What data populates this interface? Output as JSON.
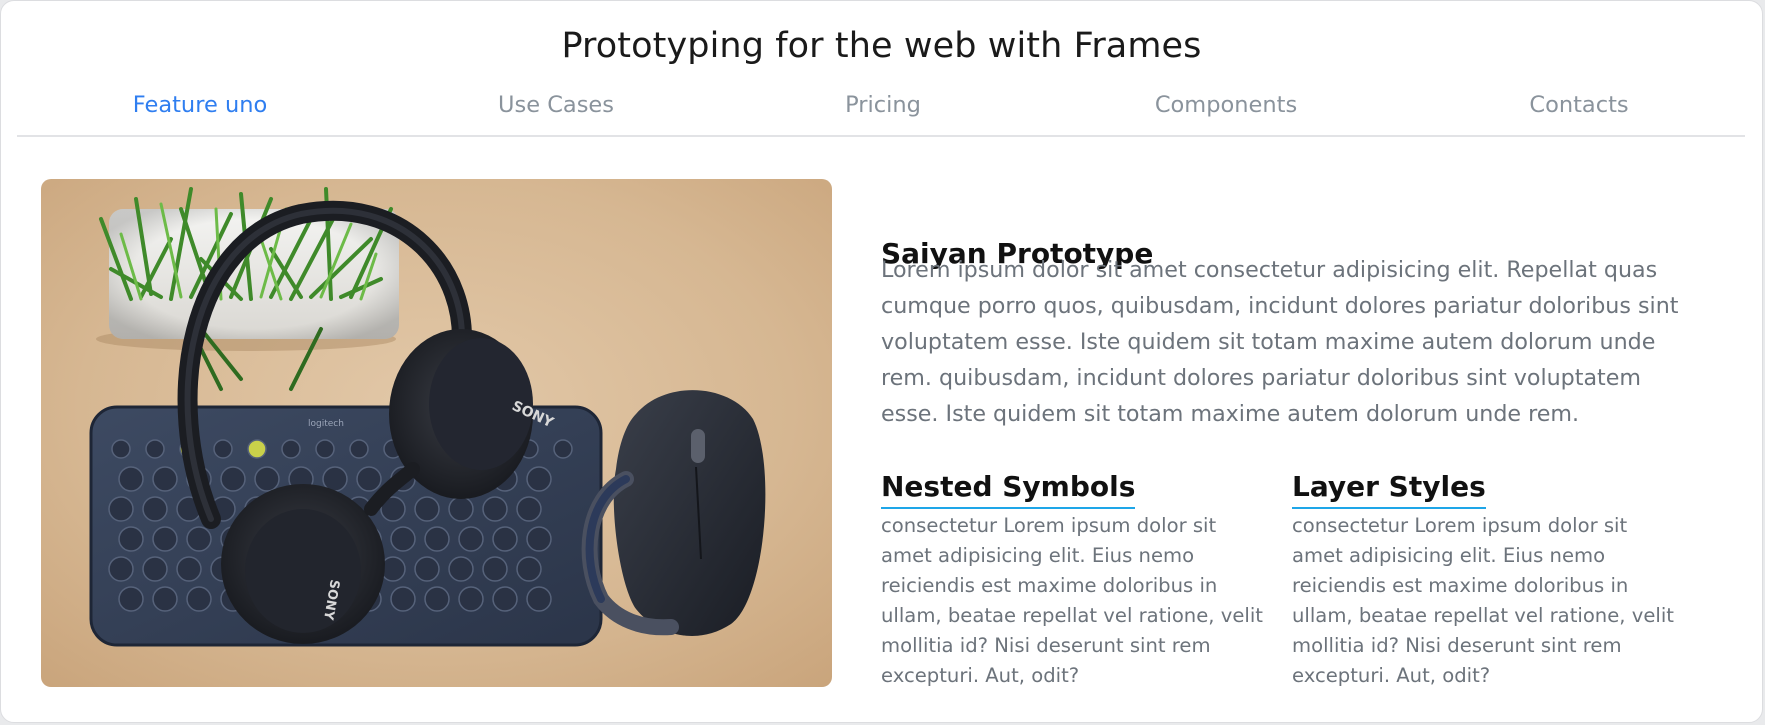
{
  "page": {
    "title": "Prototyping for the web with Frames"
  },
  "nav": {
    "tabs": [
      {
        "label": "Feature uno",
        "active": true
      },
      {
        "label": "Use Cases",
        "active": false
      },
      {
        "label": "Pricing",
        "active": false
      },
      {
        "label": "Components",
        "active": false
      },
      {
        "label": "Contacts",
        "active": false
      }
    ]
  },
  "hero": {
    "image_icon": "headphones-keyboard-mouse-photo",
    "photo_labels": {
      "headphones_brand": "SONY",
      "keyboard_brand": "logitech"
    }
  },
  "main": {
    "heading": "Saiyan Prototype",
    "paragraph": "Lorem ipsum dolor sit amet consectetur adipisicing elit. Repellat quas cumque porro quos, quibusdam, incidunt dolores pariatur doloribus sint voluptatem esse. Iste quidem sit totam maxime autem dolorum unde rem. quibusdam, incidunt dolores pariatur doloribus sint voluptatem esse. Iste quidem sit totam maxime autem dolorum unde rem."
  },
  "features": [
    {
      "title": "Nested Symbols",
      "text": "consectetur Lorem ipsum dolor sit amet adipisicing elit. Eius nemo reiciendis est maxime doloribus in ullam, beatae repellat vel ratione, velit mollitia id? Nisi deserunt sint rem excepturi. Aut, odit?"
    },
    {
      "title": "Layer Styles",
      "text": "consectetur Lorem ipsum dolor sit amet adipisicing elit. Eius nemo reiciendis est maxime doloribus in ullam, beatae repellat vel ratione, velit mollitia id? Nisi deserunt sint rem excepturi. Aut, odit?"
    }
  ],
  "colors": {
    "accent": "#2f7ef0",
    "underline": "#1ea6e8",
    "muted_text": "#6c737b",
    "tab_text": "#8a939c"
  }
}
